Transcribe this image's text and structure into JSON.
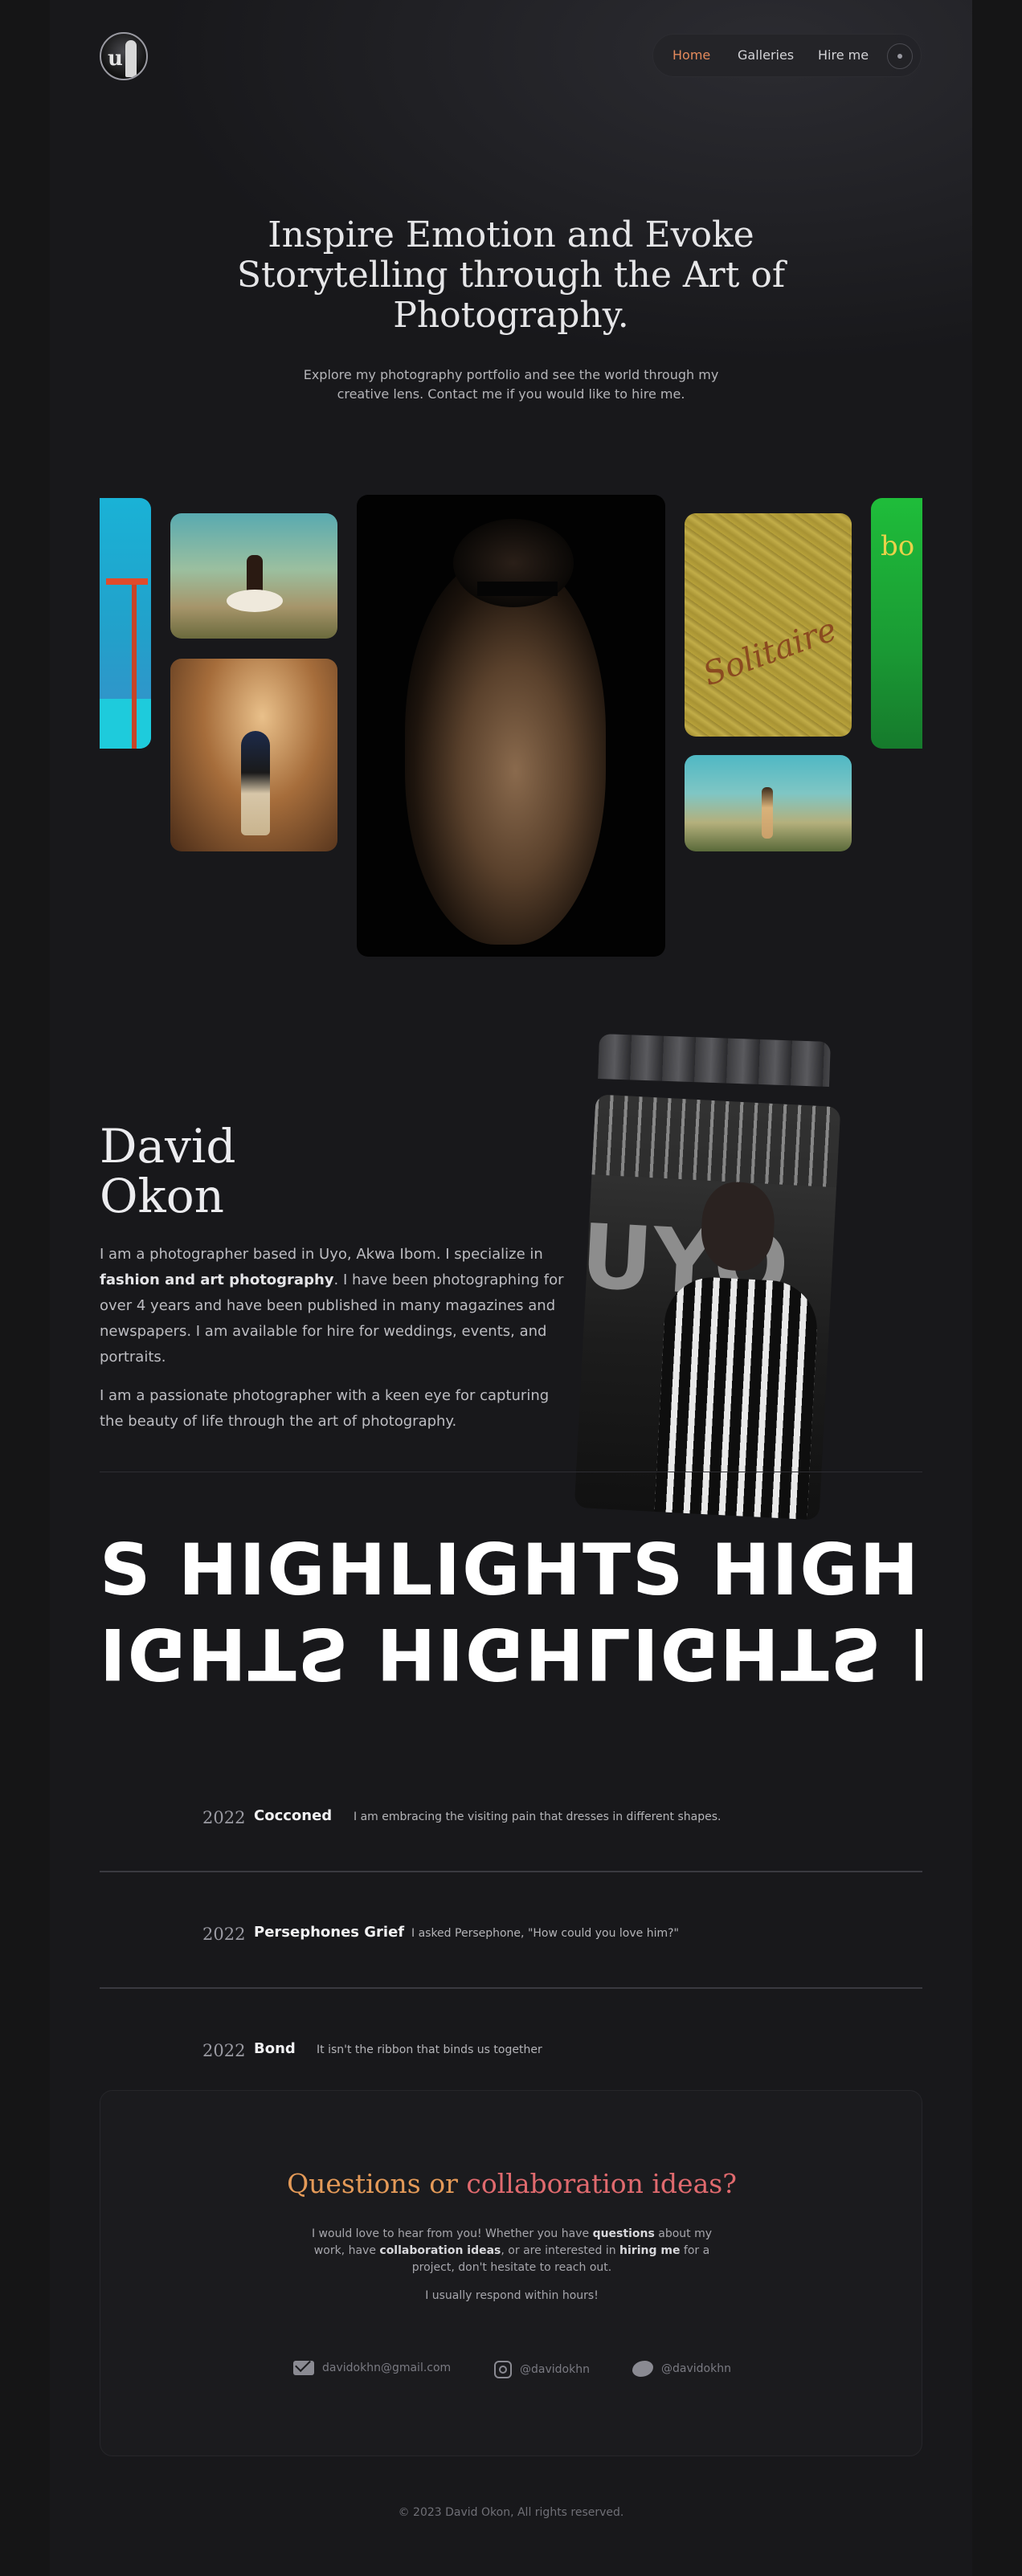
{
  "header": {
    "logo_text": "u",
    "nav": [
      {
        "label": "Home",
        "active": true
      },
      {
        "label": "Galleries",
        "active": false
      },
      {
        "label": "Hire me",
        "active": false
      }
    ],
    "theme_toggle_icon": "sun-icon"
  },
  "hero": {
    "title_line1": "Inspire Emotion and Evoke",
    "title_line2": "Storytelling through the Art of",
    "title_line3": "Photography.",
    "subtitle_line1": "Explore my photography portfolio and see the world through my",
    "subtitle_line2": "creative lens. Contact me if you would like to hire me."
  },
  "gallery": {
    "gold_signature": "Solitaire",
    "green_text": "bo"
  },
  "about": {
    "first_name": "David",
    "last_name": "Okon",
    "p1_before": "I am a photographer based in Uyo, Akwa Ibom. I specialize in",
    "p1_bold": "fashion and art photography",
    "p1_after": ". I have been photographing for over 4 years and have been published in many magazines and newspapers. I am available for hire for weddings, events, and portraits.",
    "p2": "I am a passionate photographer with a keen eye for capturing the beauty of life through the art of photography.",
    "portrait_letters": "UYO"
  },
  "highlights": {
    "marquee_text": "S HIGHLIGHTS HIGHLIGHTS HIGH",
    "marquee_flipped": "IGHTS HIGHLIGHTS HIGHLIGHTS"
  },
  "timeline": [
    {
      "year": "2022",
      "title": "Cocconed",
      "desc": "I am embracing the visiting pain that dresses in different shapes."
    },
    {
      "year": "2022",
      "title": "Persephones Grief",
      "desc": "I asked Persephone, \"How could you love him?\""
    },
    {
      "year": "2022",
      "title": "Bond",
      "desc": "It isn't the ribbon that binds us together"
    }
  ],
  "contact": {
    "title_part1": "Questions or",
    "title_part2": "collaboration ideas?",
    "p1_a": "I would love to hear from you! Whether you have",
    "p1_b": "questions",
    "p1_c": "about my work, have",
    "p1_d": "collaboration ideas",
    "p1_e": ", or are interested in",
    "p1_f": "hiring me",
    "p1_g": "for a project, don't hesitate to reach out.",
    "p2": "I usually respond within hours!",
    "email": "davidokhn@gmail.com",
    "instagram": "@davidokhn",
    "twitter": "@davidokhn"
  },
  "footer": {
    "copyright": "© 2023 David Okon, All rights reserved."
  }
}
